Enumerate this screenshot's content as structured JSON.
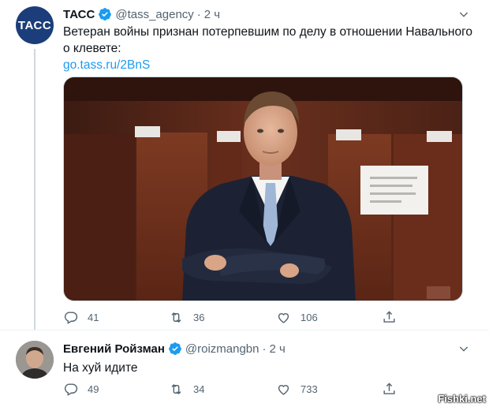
{
  "tweets": [
    {
      "name": "ТАСС",
      "handle": "@tass_agency",
      "separator": "·",
      "time": "2 ч",
      "avatar_text": "ТАСС",
      "text": "Ветеран войны признан потерпевшим по делу в отношении Навального о клевете:",
      "link": "go.tass.ru/2BnS",
      "replies": "41",
      "retweets": "36",
      "likes": "106"
    },
    {
      "name": "Евгений Ройзман",
      "handle": "@roizmangbn",
      "separator": "·",
      "time": "2 ч",
      "text": "На хуй идите",
      "replies": "49",
      "retweets": "34",
      "likes": "733"
    }
  ],
  "watermark": "Fishki.net",
  "colors": {
    "verified": "#1d9bf0",
    "link": "#1d9bf0",
    "secondary_text": "#536471",
    "tass_avatar": "#1b3e7a"
  },
  "icons": [
    "verified-badge-icon",
    "chevron-down-icon",
    "reply-icon",
    "retweet-icon",
    "like-icon",
    "share-icon"
  ]
}
